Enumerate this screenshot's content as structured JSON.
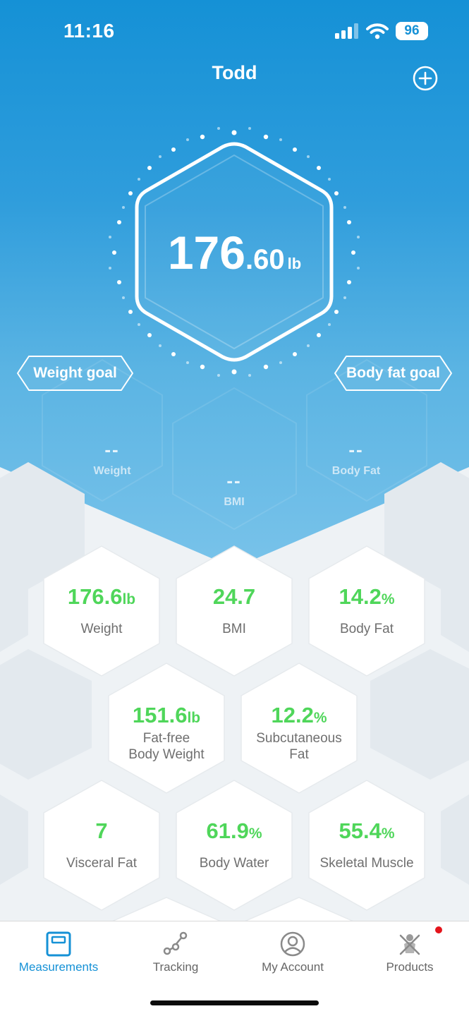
{
  "status_bar": {
    "time": "11:16",
    "battery": "96"
  },
  "header": {
    "title": "Todd"
  },
  "current_weight": {
    "integer": "176",
    "decimal": ".60",
    "unit": "lb"
  },
  "goals": {
    "weight_goal": "Weight goal",
    "body_fat_goal": "Body fat goal"
  },
  "summary": {
    "weight": {
      "value": "--",
      "label": "Weight"
    },
    "bmi": {
      "value": "--",
      "label": "BMI"
    },
    "body_fat": {
      "value": "--",
      "label": "Body Fat"
    }
  },
  "metrics": [
    {
      "value": "176.6",
      "unit": "lb",
      "label": "Weight"
    },
    {
      "value": "24.7",
      "unit": "",
      "label": "BMI"
    },
    {
      "value": "14.2",
      "unit": "%",
      "label": "Body Fat"
    },
    {
      "value": "151.6",
      "unit": "lb",
      "label_line1": "Fat-free",
      "label_line2": "Body Weight"
    },
    {
      "value": "12.2",
      "unit": "%",
      "label_line1": "Subcutaneous",
      "label_line2": "Fat"
    },
    {
      "value": "7",
      "unit": "",
      "label": "Visceral Fat"
    },
    {
      "value": "61.9",
      "unit": "%",
      "label": "Body Water"
    },
    {
      "value": "55.4",
      "unit": "%",
      "label": "Skeletal Muscle"
    }
  ],
  "tabs": [
    {
      "label": "Measurements",
      "icon": "scale-icon"
    },
    {
      "label": "Tracking",
      "icon": "tracking-icon"
    },
    {
      "label": "My Account",
      "icon": "account-icon"
    },
    {
      "label": "Products",
      "icon": "products-icon"
    }
  ],
  "colors": {
    "brand_blue": "#1591d6",
    "metric_green": "#4fd65a",
    "notification_red": "#e4141b"
  }
}
